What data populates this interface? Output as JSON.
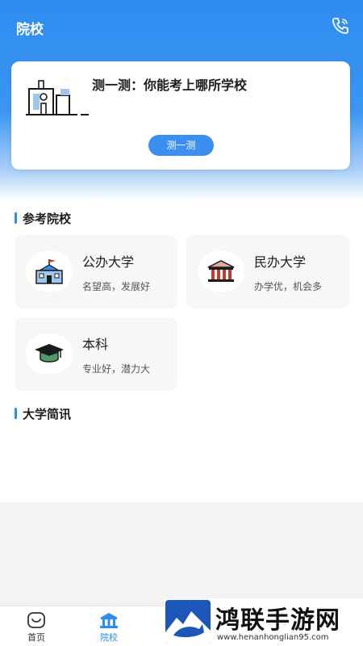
{
  "header": {
    "title": "院校",
    "phone_icon": "phone-icon"
  },
  "quiz": {
    "title": "测一测：你能考上哪所学校",
    "button_label": "测一测"
  },
  "reference": {
    "section_title": "参考院校",
    "cards": [
      {
        "title": "公办大学",
        "subtitle": "名望高，发展好",
        "icon": "school-building-icon"
      },
      {
        "title": "民办大学",
        "subtitle": "办学优，机会多",
        "icon": "institution-icon"
      },
      {
        "title": "本科",
        "subtitle": "专业好，潜力大",
        "icon": "graduation-cap-icon"
      }
    ]
  },
  "news": {
    "section_title": "大学简讯"
  },
  "tabbar": {
    "tabs": [
      {
        "label": "首页",
        "icon": "home-icon",
        "active": false
      },
      {
        "label": "院校",
        "icon": "school-icon",
        "active": true
      }
    ],
    "active_color": "#2d8df0"
  },
  "watermark": {
    "text": "鸿联手游网",
    "url": "www.henanhonglian95.com"
  },
  "colors": {
    "primary": "#2d8df0",
    "card_bg": "#f5f7f9",
    "red_accent": "#c23b32",
    "green_accent": "#4f9a66"
  }
}
